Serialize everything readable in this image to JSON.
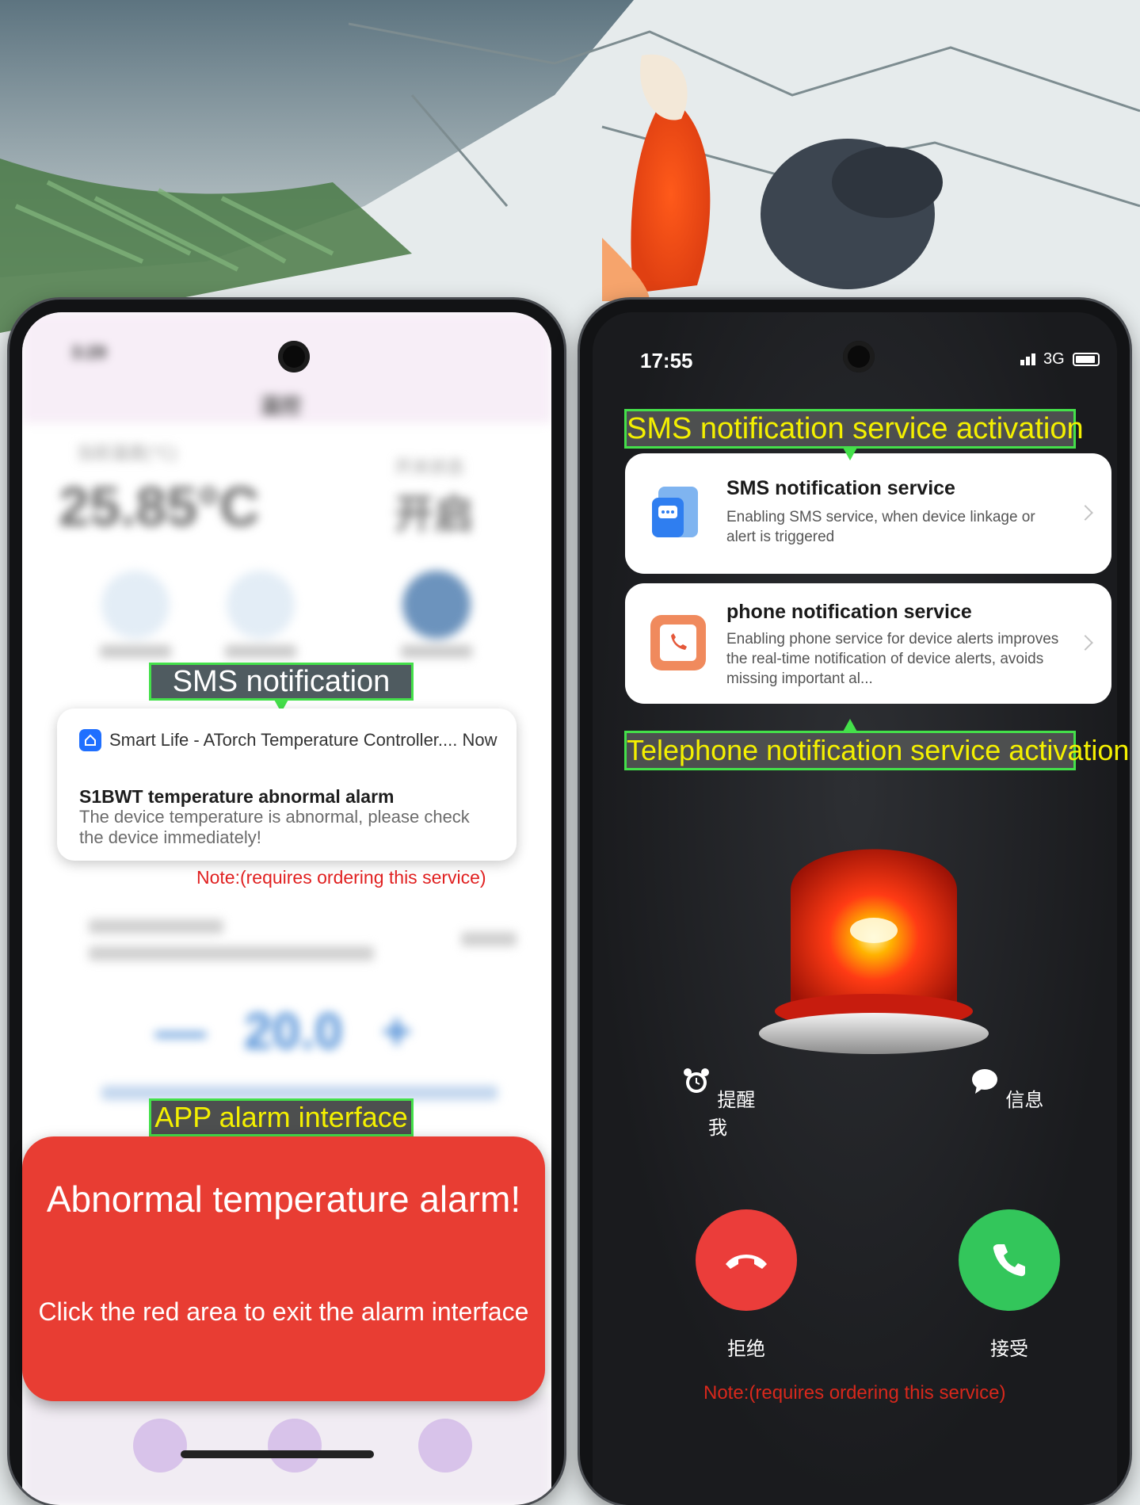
{
  "left_phone": {
    "blurred_app": {
      "temperature": "25.85°C",
      "stepper_value": "20.0",
      "stepper_minus": "—",
      "stepper_plus": "+"
    },
    "labels": {
      "sms_notification": "SMS notification",
      "app_alarm_interface": "APP alarm interface"
    },
    "notification": {
      "app_line": "Smart Life - ATorch Temperature Controller.... Now",
      "title": "S1BWT temperature abnormal alarm",
      "body": "The device temperature is abnormal, please check the device immediately!"
    },
    "note": "Note:(requires ordering this service)",
    "alarm": {
      "title": "Abnormal temperature alarm!",
      "subtitle": "Click the red area to exit the alarm interface"
    }
  },
  "right_phone": {
    "status_bar": {
      "time": "17:55",
      "network": "3G"
    },
    "labels": {
      "sms_activation": "SMS notification service activation",
      "telephone_activation": "Telephone notification service activation"
    },
    "sms_service": {
      "title": "SMS notification service",
      "description": "Enabling SMS service,  when device linkage or  alert is triggered"
    },
    "phone_service": {
      "title": "phone notification service",
      "description": "Enabling phone service for device alerts improves the real-time notification of device alerts, avoids missing important al..."
    },
    "call_controls": {
      "remind_me": "提醒我",
      "message": "信息",
      "decline": "拒绝",
      "accept": "接受"
    },
    "note": "Note:(requires ordering this service)"
  },
  "colors": {
    "alarm_red": "#e83d33",
    "callout_border": "#44e04a",
    "callout_text_yellow": "#f4f000",
    "note_red": "#e02020",
    "decline_red": "#eb3d3a",
    "accept_green": "#33c65b"
  }
}
